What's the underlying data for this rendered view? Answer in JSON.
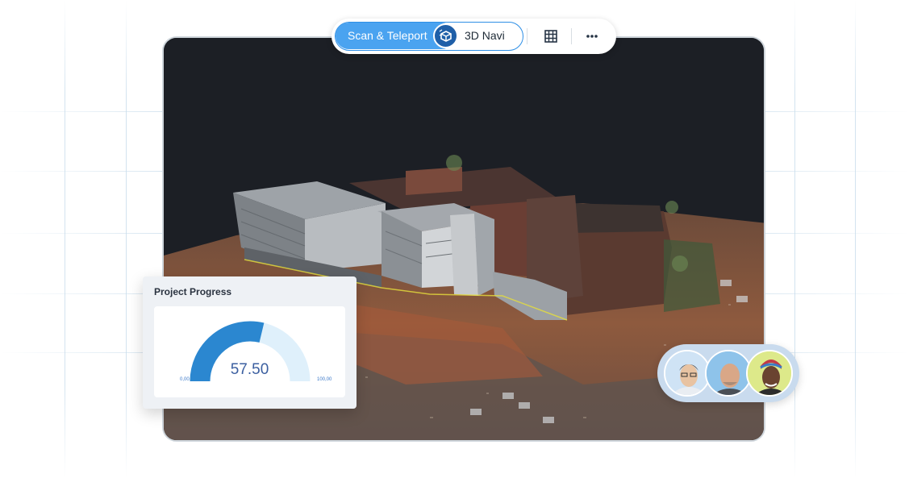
{
  "toolbar": {
    "scan_teleport_label": "Scan & Teleport",
    "navi_label": "3D Navi",
    "mode_icon": "scan-teleport-icon",
    "grid_icon": "grid-icon",
    "more_icon": "more-icon"
  },
  "progress_card": {
    "title": "Project Progress",
    "value": "57.50",
    "value_fraction": 0.575,
    "min_label": "0,00",
    "max_label": "100,00"
  },
  "collaborators": [
    {
      "name": "avatar-1"
    },
    {
      "name": "avatar-2"
    },
    {
      "name": "avatar-3"
    }
  ],
  "colors": {
    "accent": "#4aa3f0",
    "gauge_fill": "#2b87d0",
    "gauge_track": "#dff0fb"
  }
}
